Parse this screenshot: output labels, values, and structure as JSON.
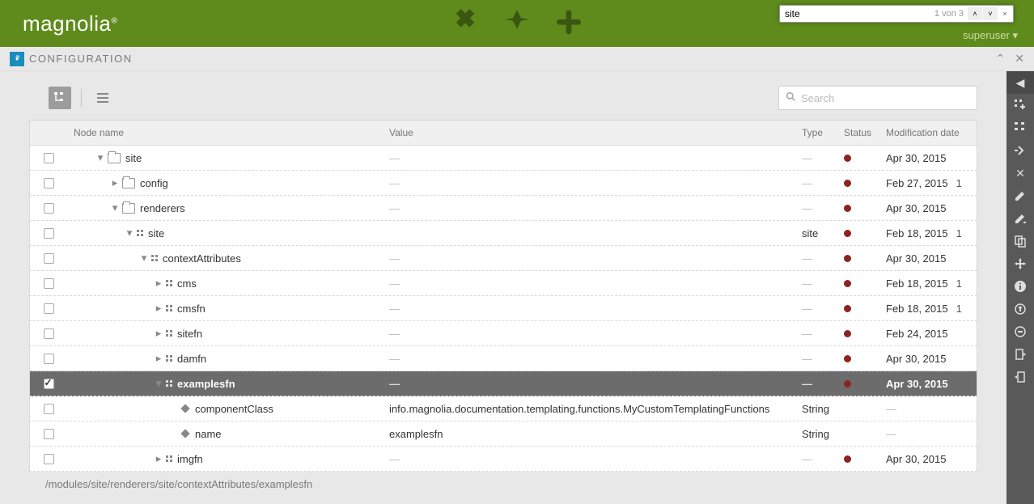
{
  "brand": "magnolia",
  "findbar": {
    "value": "site",
    "count": "1 von 3"
  },
  "user": "superuser",
  "app": {
    "title": "CONFIGURATION"
  },
  "search": {
    "placeholder": "Search"
  },
  "columns": {
    "name": "Node name",
    "value": "Value",
    "type": "Type",
    "status": "Status",
    "mod": "Modification date"
  },
  "rows": [
    {
      "indent": 2,
      "expand": "down",
      "icon": "folder",
      "name": "site",
      "value": "—",
      "type": "—",
      "status": "dot",
      "mod": "Apr 30, 2015",
      "extra": "",
      "checked": false
    },
    {
      "indent": 3,
      "expand": "right",
      "icon": "folder",
      "name": "config",
      "value": "—",
      "type": "—",
      "status": "dot",
      "mod": "Feb 27, 2015",
      "extra": "1",
      "checked": false
    },
    {
      "indent": 3,
      "expand": "down",
      "icon": "folder",
      "name": "renderers",
      "value": "—",
      "type": "—",
      "status": "dot",
      "mod": "Apr 30, 2015",
      "extra": "",
      "checked": false
    },
    {
      "indent": 4,
      "expand": "down",
      "icon": "dots",
      "name": "site",
      "value": "",
      "type": "site",
      "status": "dot",
      "mod": "Feb 18, 2015",
      "extra": "1",
      "checked": false
    },
    {
      "indent": 5,
      "expand": "down",
      "icon": "dots",
      "name": "contextAttributes",
      "value": "—",
      "type": "—",
      "status": "dot",
      "mod": "Apr 30, 2015",
      "extra": "",
      "checked": false
    },
    {
      "indent": 6,
      "expand": "right",
      "icon": "dots",
      "name": "cms",
      "value": "—",
      "type": "—",
      "status": "dot",
      "mod": "Feb 18, 2015",
      "extra": "1",
      "checked": false
    },
    {
      "indent": 6,
      "expand": "right",
      "icon": "dots",
      "name": "cmsfn",
      "value": "—",
      "type": "—",
      "status": "dot",
      "mod": "Feb 18, 2015",
      "extra": "1",
      "checked": false
    },
    {
      "indent": 6,
      "expand": "right",
      "icon": "dots",
      "name": "sitefn",
      "value": "—",
      "type": "—",
      "status": "dot",
      "mod": "Feb 24, 2015",
      "extra": "",
      "checked": false
    },
    {
      "indent": 6,
      "expand": "right",
      "icon": "dots",
      "name": "damfn",
      "value": "—",
      "type": "—",
      "status": "dot",
      "mod": "Apr 30, 2015",
      "extra": "",
      "checked": false
    },
    {
      "indent": 6,
      "expand": "down",
      "icon": "dots",
      "name": "examplesfn",
      "value": "—",
      "type": "—",
      "status": "dot",
      "mod": "Apr 30, 2015",
      "extra": "",
      "checked": true,
      "selected": true
    },
    {
      "indent": 7,
      "expand": "",
      "icon": "diamond",
      "name": "componentClass",
      "value": "info.magnolia.documentation.templating.functions.MyCustomTemplatingFunctions",
      "type": "String",
      "status": "",
      "mod": "—",
      "extra": "",
      "checked": false
    },
    {
      "indent": 7,
      "expand": "",
      "icon": "diamond",
      "name": "name",
      "value": "examplesfn",
      "type": "String",
      "status": "",
      "mod": "—",
      "extra": "",
      "checked": false
    },
    {
      "indent": 6,
      "expand": "right",
      "icon": "dots",
      "name": "imgfn",
      "value": "—",
      "type": "—",
      "status": "dot",
      "mod": "Apr 30, 2015",
      "extra": "",
      "checked": false
    }
  ],
  "path": "/modules/site/renderers/site/contextAttributes/examplesfn"
}
